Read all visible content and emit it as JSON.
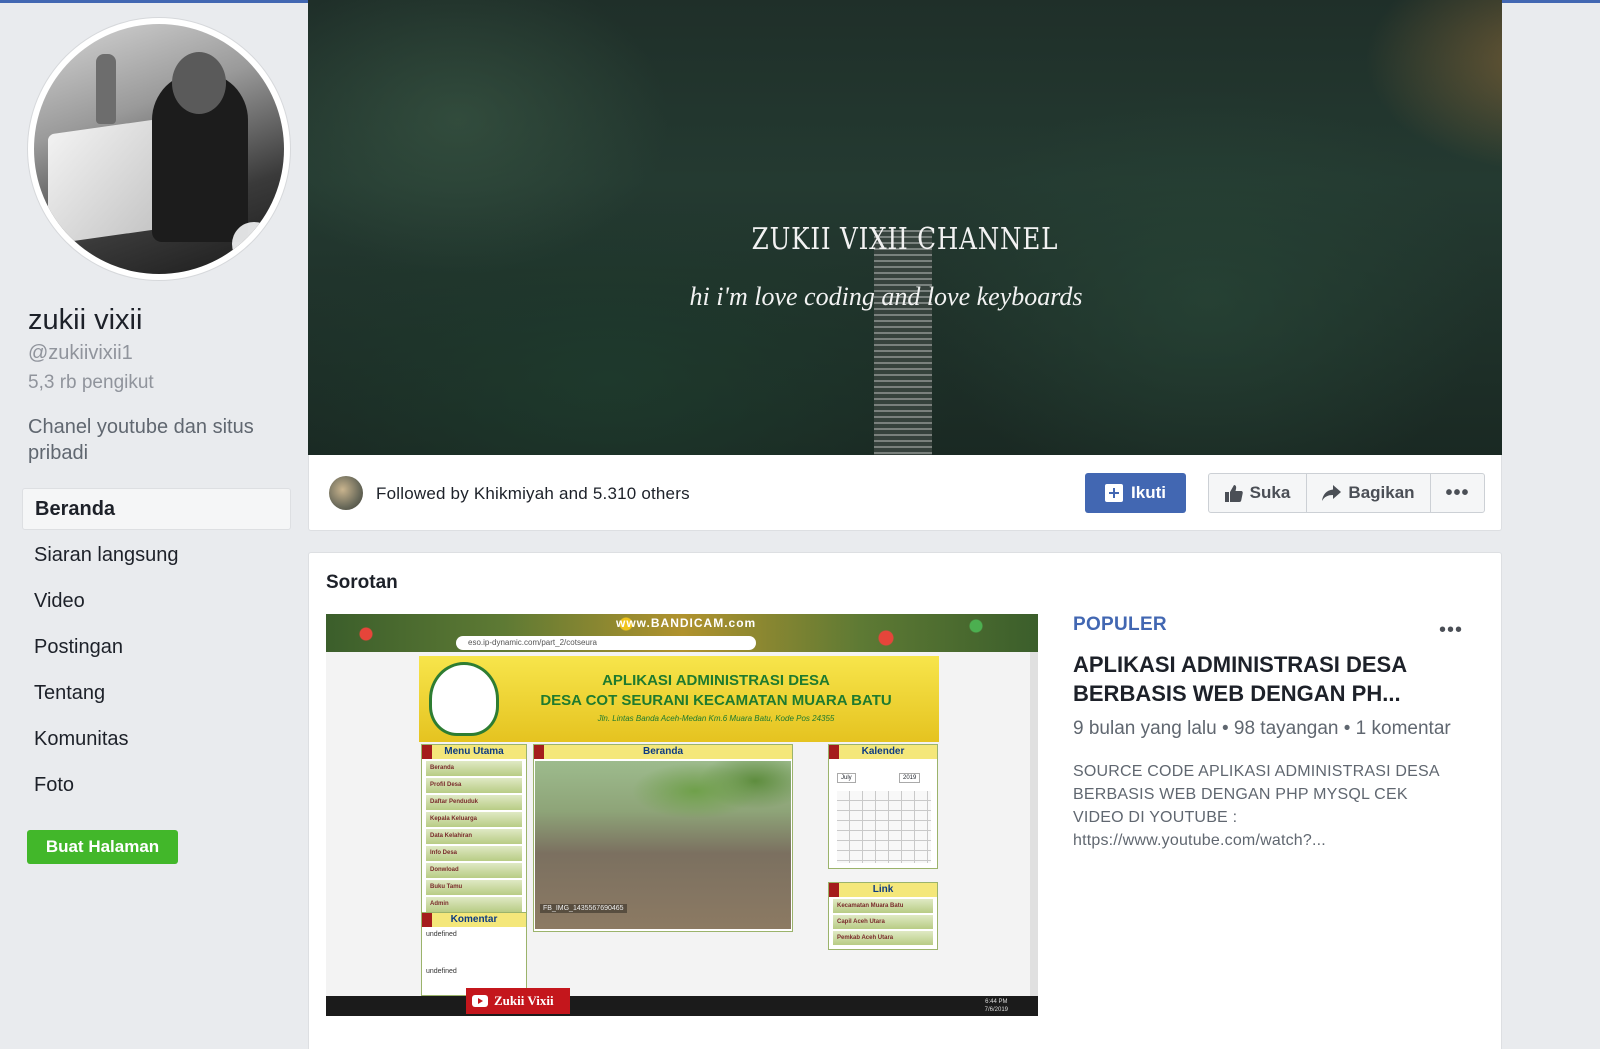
{
  "colors": {
    "page_bg": "#e9ebee",
    "fb_blue": "#4267b2",
    "green": "#42b72a",
    "muted": "#90949c"
  },
  "profile": {
    "name": "zukii vixii",
    "handle": "@zukiivixii1",
    "followers": "5,3 rb pengikut",
    "description": "Chanel youtube dan situs pribadi"
  },
  "nav": {
    "items": [
      {
        "label": "Beranda",
        "active": true
      },
      {
        "label": "Siaran langsung"
      },
      {
        "label": "Video"
      },
      {
        "label": "Postingan"
      },
      {
        "label": "Tentang"
      },
      {
        "label": "Komunitas"
      },
      {
        "label": "Foto"
      }
    ]
  },
  "create_page_label": "Buat Halaman",
  "cover": {
    "title": "ZUKII VIXII CHANNEL",
    "subtitle": "hi i'm  love coding and  love keyboards"
  },
  "actionbar": {
    "followed_by": "Followed by Khikmiyah and 5.310 others",
    "follow_label": "Ikuti",
    "like_label": "Suka",
    "share_label": "Bagikan",
    "more_label": "•••",
    "icons": {
      "follow": "add-page-icon",
      "like": "thumbs-up-icon",
      "share": "share-arrow-icon"
    }
  },
  "highlights": {
    "title": "Sorotan",
    "video": {
      "badge": "POPULER",
      "title": "APLIKASI ADMINISTRASI DESA BERBASIS WEB DENGAN PH...",
      "stats": "9 bulan yang lalu • 98 tayangan • 1 komentar",
      "description": "SOURCE CODE APLIKASI ADMINISTRASI DESA BERBASIS WEB DENGAN PHP MYSQL CEK VIDEO DI YOUTUBE : https://www.youtube.com/watch?...",
      "more_label": "•••",
      "thumbnail": {
        "watermark": "www.BANDICAM.com",
        "url": "eso.ip-dynamic.com/part_2/cotseura",
        "header_line1": "APLIKASI ADMINISTRASI DESA",
        "header_line2": "DESA COT SEURANI KECAMATAN MUARA BATU",
        "header_line3": "Jln. Lintas Banda Aceh-Medan Km.6 Muara Batu, Kode Pos 24355",
        "menu_title": "Menu Utama",
        "menu_items": [
          "Beranda",
          "Profil Desa",
          "Daftar Penduduk",
          "Kepala Keluarga",
          "Data Kelahiran",
          "Info Desa",
          "Donwload",
          "Buku Tamu",
          "Admin"
        ],
        "comment_title": "Komentar",
        "comment_1": "undefined",
        "comment_2": "undefined",
        "main_title": "Beranda",
        "photo_label": "FB_IMG_1435567690465",
        "calendar_title": "Kalender",
        "calendar_month": "July",
        "calendar_year": "2019",
        "link_title": "Link",
        "link_items": [
          "Kecamatan Muara Batu",
          "Capil Aceh Utara",
          "Pemkab Aceh Utara"
        ],
        "channel_label": "Zukii Vixii",
        "clock_time": "6:44 PM",
        "clock_date": "7/6/2019"
      }
    }
  }
}
